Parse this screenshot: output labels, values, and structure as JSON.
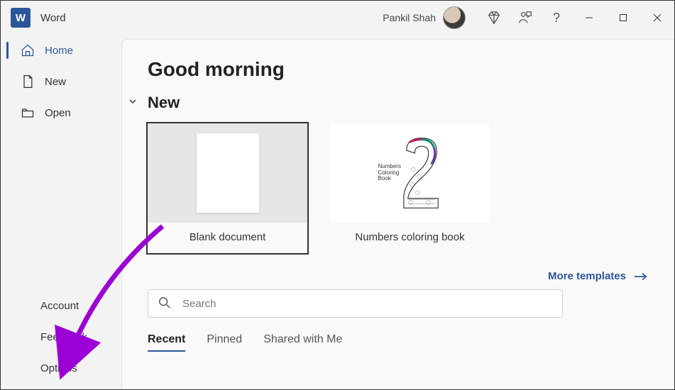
{
  "app": {
    "name": "Word",
    "icon_letter": "W"
  },
  "user": {
    "name": "Pankil Shah"
  },
  "window_controls": {
    "minimize": "minimize",
    "maximize": "maximize",
    "close": "close"
  },
  "title_icons": {
    "diamond": "diamond-icon",
    "feedback": "feedback-icon",
    "help": "?"
  },
  "sidebar": {
    "items": [
      {
        "label": "Home",
        "icon": "home-icon",
        "active": true
      },
      {
        "label": "New",
        "icon": "document-icon",
        "active": false
      },
      {
        "label": "Open",
        "icon": "folder-icon",
        "active": false
      }
    ],
    "bottom": [
      {
        "label": "Account"
      },
      {
        "label": "Feedback"
      },
      {
        "label": "Options"
      }
    ]
  },
  "main": {
    "greeting": "Good morning",
    "new_section": {
      "title": "New",
      "templates": [
        {
          "name": "Blank document",
          "selected": true
        },
        {
          "name": "Numbers coloring book",
          "selected": false,
          "thumb_text": "Numbers Coloring Book"
        }
      ],
      "more_link": "More templates"
    },
    "search": {
      "placeholder": "Search"
    },
    "tabs": [
      {
        "label": "Recent",
        "active": true
      },
      {
        "label": "Pinned",
        "active": false
      },
      {
        "label": "Shared with Me",
        "active": false
      }
    ]
  },
  "colors": {
    "accent": "#2b579a",
    "annotation": "#9b00d4"
  }
}
